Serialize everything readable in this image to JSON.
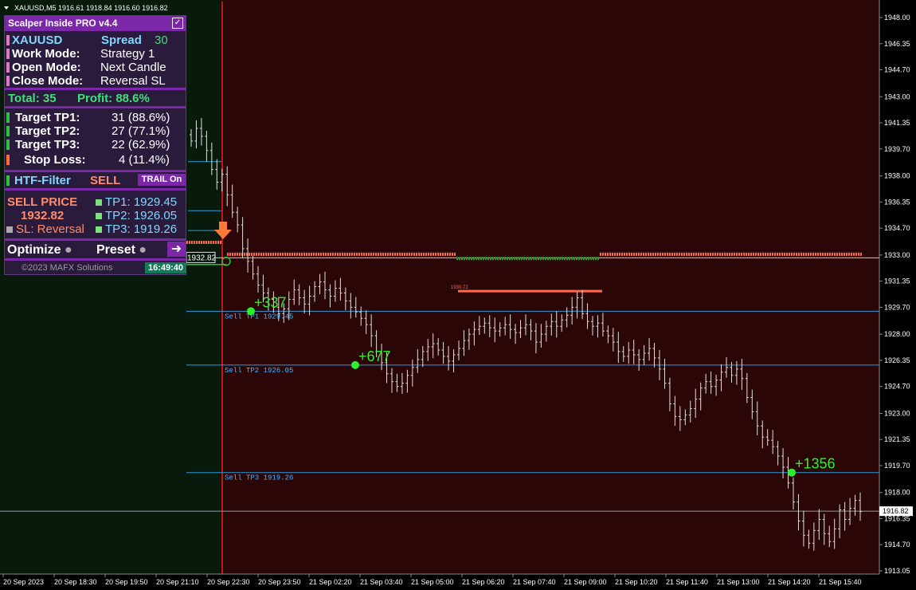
{
  "chart_header": "XAUUSD,M5  1916.61 1918.84 1916.60 1916.82",
  "colors": {
    "bg_left": "#071a0c",
    "bg_right": "#2a0606",
    "accent": "#7a28a8",
    "green": "#3fe07a",
    "salmon": "#ff6a4a",
    "cyan_line": "#2a9ad8"
  },
  "panel": {
    "title": "Scalper Inside PRO v4.4",
    "symbol": "XAUUSD",
    "spread_label": "Spread",
    "spread_value": "30",
    "work_mode_label": "Work Mode:",
    "work_mode_value": "Strategy 1",
    "open_mode_label": "Open Mode:",
    "open_mode_value": "Next Candle",
    "close_mode_label": "Close Mode:",
    "close_mode_value": "Reversal SL",
    "total": "Total: 35",
    "profit": "Profit: 88.6%",
    "tp1_label": "Target TP1:",
    "tp1_value": "31 (88.6%)",
    "tp2_label": "Target TP2:",
    "tp2_value": "27 (77.1%)",
    "tp3_label": "Target TP3:",
    "tp3_value": "22 (62.9%)",
    "sl_label": "Stop Loss:",
    "sl_value": "4 (11.4%)",
    "htf_label": "HTF-Filter",
    "htf_value": "SELL",
    "trail_label": "TRAIL On",
    "sell_price_label": "SELL PRICE",
    "sell_price_value": "1932.82",
    "sl_reversal": "SL: Reversal",
    "tp1_price": "TP1: 1929.45",
    "tp2_price": "TP2: 1926.05",
    "tp3_price": "TP3: 1919.26",
    "optimize_label": "Optimize",
    "preset_label": "Preset",
    "copyright": "©2023 MAFX Solutions",
    "clock": "16:49:40"
  },
  "price_axis": {
    "ticks": [
      "1948.00",
      "1946.35",
      "1944.70",
      "1943.00",
      "1941.35",
      "1939.70",
      "1938.00",
      "1936.35",
      "1934.70",
      "1933.00",
      "1931.35",
      "1929.70",
      "1928.00",
      "1926.35",
      "1924.70",
      "1923.00",
      "1921.35",
      "1919.70",
      "1918.00",
      "1916.35",
      "1914.70",
      "1913.05"
    ],
    "current": "1916.82"
  },
  "time_axis": [
    "20 Sep 2023",
    "20 Sep 18:30",
    "20 Sep 19:50",
    "20 Sep 21:10",
    "20 Sep 22:30",
    "20 Sep 23:50",
    "21 Sep 02:20",
    "21 Sep 03:40",
    "21 Sep 05:00",
    "21 Sep 06:20",
    "21 Sep 07:40",
    "21 Sep 09:00",
    "21 Sep 10:20",
    "21 Sep 11:40",
    "21 Sep 13:00",
    "21 Sep 14:20",
    "21 Sep 15:40"
  ],
  "levels": {
    "entry_label": "1932.82",
    "sell_tp1": "Sell TP1 1929.45",
    "sell_tp2": "Sell TP2 1926.05",
    "sell_tp3": "Sell TP3 1919.26",
    "small_label": "1930.72"
  },
  "markers": {
    "m1": "+337",
    "m2": "+677",
    "m3": "+1356"
  },
  "chart_data": {
    "type": "ohlc",
    "ylim": [
      1913.05,
      1948.0
    ],
    "close_series": [
      1940.2,
      1941.0,
      1940.5,
      1939.6,
      1938.4,
      1937.6,
      1938.1,
      1936.8,
      1935.7,
      1934.9,
      1933.4,
      1932.6,
      1931.8,
      1931.1,
      1930.6,
      1930.2,
      1929.7,
      1929.3,
      1929.6,
      1930.2,
      1930.8,
      1930.3,
      1929.9,
      1930.4,
      1931.0,
      1931.3,
      1930.8,
      1930.4,
      1930.9,
      1930.6,
      1930.1,
      1929.7,
      1929.4,
      1929.0,
      1928.6,
      1927.9,
      1926.9,
      1926.2,
      1925.5,
      1925.0,
      1924.7,
      1924.9,
      1925.4,
      1925.9,
      1926.4,
      1926.9,
      1927.2,
      1927.4,
      1927.0,
      1926.6,
      1926.3,
      1926.7,
      1927.1,
      1927.6,
      1928.0,
      1928.3,
      1928.5,
      1928.7,
      1928.4,
      1928.2,
      1928.4,
      1928.6,
      1928.3,
      1928.1,
      1928.4,
      1928.6,
      1928.2,
      1927.5,
      1928.0,
      1928.5,
      1928.8,
      1928.5,
      1928.9,
      1929.2,
      1929.7,
      1930.3,
      1929.3,
      1928.8,
      1928.5,
      1928.7,
      1928.2,
      1927.9,
      1927.5,
      1926.9,
      1926.6,
      1927.0,
      1926.7,
      1926.4,
      1926.8,
      1927.1,
      1926.5,
      1925.8,
      1924.9,
      1923.6,
      1922.8,
      1922.6,
      1922.9,
      1923.3,
      1923.9,
      1924.6,
      1925.0,
      1924.7,
      1925.1,
      1925.6,
      1925.9,
      1925.4,
      1925.8,
      1925.2,
      1924.0,
      1923.1,
      1922.2,
      1921.5,
      1921.3,
      1920.9,
      1920.3,
      1919.6,
      1918.6,
      1917.4,
      1916.2,
      1915.3,
      1914.8,
      1915.6,
      1916.3,
      1915.4,
      1914.9,
      1915.7,
      1916.9,
      1916.3,
      1917.0,
      1917.5,
      1916.8
    ]
  }
}
